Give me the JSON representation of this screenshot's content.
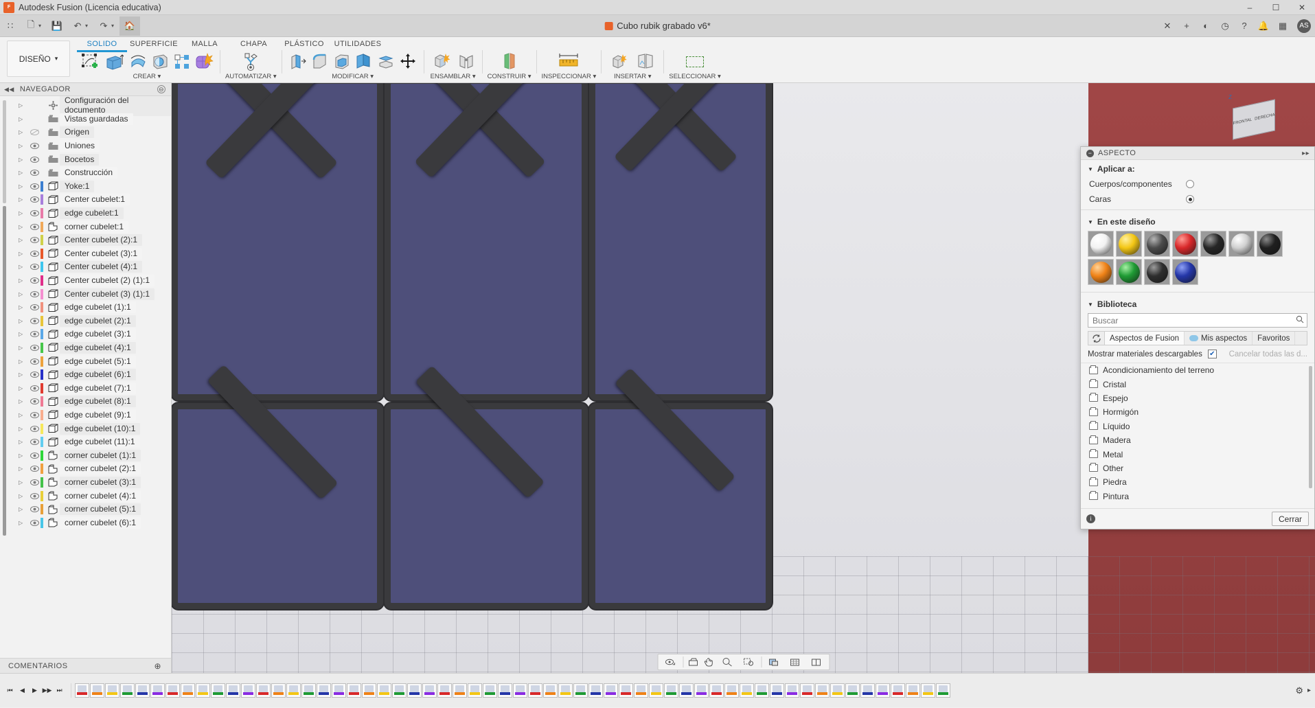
{
  "titlebar": {
    "app_name": "Autodesk Fusion (Licencia educativa)",
    "app_icon": "fusion-logo-icon",
    "minimize": "–",
    "maximize": "☐",
    "close": "✕"
  },
  "quickaccess": {
    "grid_icon": "∷",
    "new_icon": "🗋",
    "save_icon": "💾",
    "undo_icon": "↶",
    "redo_icon": "↷",
    "home_icon": "🏠",
    "caret": "▾",
    "document_name": "Cubo rubik grabado v6*",
    "doc_close": "✕",
    "add_tab": "+",
    "extensions_icon": "◐",
    "help_icon": "?",
    "jobs_icon": "◷",
    "notify_icon": "🔔",
    "grid_right_icon": "▦",
    "user_initials": "AS"
  },
  "ribbon": {
    "workspace_label": "DISEÑO",
    "workspace_caret": "▾",
    "tabs": [
      {
        "label": "SOLIDO",
        "active": true
      },
      {
        "label": "SUPERFICIE",
        "active": false
      },
      {
        "label": "MALLA",
        "active": false
      },
      {
        "label": "CHAPA",
        "active": false
      },
      {
        "label": "PLÁSTICO",
        "active": false
      },
      {
        "label": "UTILIDADES",
        "active": false
      }
    ],
    "groups": [
      {
        "label": "CREAR ▾",
        "icons": [
          "create-sketch-icon",
          "extrude-icon",
          "revolve-icon",
          "sweep-icon",
          "loft-icon",
          "pattern-icon",
          "form-icon"
        ]
      },
      {
        "label": "AUTOMATIZAR ▾",
        "icons": [
          "automate-icon"
        ]
      },
      {
        "label": "MODIFICAR ▾",
        "icons": [
          "press-pull-icon",
          "fillet-icon",
          "shell-icon",
          "draft-icon",
          "split-body-icon",
          "move-copy-icon"
        ]
      },
      {
        "label": "ENSAMBLAR ▾",
        "icons": [
          "new-component-icon",
          "joint-icon"
        ]
      },
      {
        "label": "CONSTRUIR ▾",
        "icons": [
          "construction-plane-icon"
        ]
      },
      {
        "label": "INSPECCIONAR ▾",
        "icons": [
          "measure-icon"
        ]
      },
      {
        "label": "INSERTAR ▾",
        "icons": [
          "insert-derive-icon",
          "insert-canvas-icon"
        ]
      },
      {
        "label": "SELECCIONAR ▾",
        "icons": [
          "window-selection-icon"
        ]
      }
    ]
  },
  "navigator": {
    "title": "NAVEGADOR",
    "collapse_icon": "◀◀",
    "options_icon": "⊖",
    "arrow": "▷",
    "eye_visible": "◉",
    "eye_hidden": "⊘",
    "footer": "COMENTARIOS",
    "footer_icon": "⊕",
    "items": [
      {
        "label": "Configuración del documento",
        "icon": "gear-icon",
        "swatch": "",
        "eye": "none",
        "indent": 0
      },
      {
        "label": "Vistas guardadas",
        "icon": "folder-icon",
        "swatch": "",
        "eye": "none",
        "indent": 1
      },
      {
        "label": "Origen",
        "icon": "folder-icon",
        "swatch": "",
        "eye": "hidden",
        "indent": 1
      },
      {
        "label": "Uniones",
        "icon": "folder-icon",
        "swatch": "",
        "eye": "visible",
        "indent": 1
      },
      {
        "label": "Bocetos",
        "icon": "folder-icon",
        "swatch": "",
        "eye": "visible",
        "indent": 1
      },
      {
        "label": "Construcción",
        "icon": "folder-icon",
        "swatch": "",
        "eye": "visible",
        "indent": 1
      },
      {
        "label": "Yoke:1",
        "icon": "component-icon",
        "swatch": "#3d7fd0",
        "eye": "visible",
        "indent": 1
      },
      {
        "label": "Center cubelet:1",
        "icon": "component-icon",
        "swatch": "#a87fdc",
        "eye": "visible",
        "indent": 1
      },
      {
        "label": "edge cubelet:1",
        "icon": "component-icon",
        "swatch": "#e87ba8",
        "eye": "visible",
        "indent": 1
      },
      {
        "label": "corner cubelet:1",
        "icon": "corner-component-icon",
        "swatch": "#f0a95a",
        "eye": "visible",
        "indent": 1
      },
      {
        "label": "Center cubelet (2):1",
        "icon": "component-icon",
        "swatch": "#cfd14a",
        "eye": "visible",
        "indent": 1
      },
      {
        "label": "Center cubelet (3):1",
        "icon": "component-icon",
        "swatch": "#e8582a",
        "eye": "visible",
        "indent": 1
      },
      {
        "label": "Center cubelet (4):1",
        "icon": "component-icon",
        "swatch": "#3fc6ee",
        "eye": "visible",
        "indent": 1
      },
      {
        "label": "Center cubelet (2) (1):1",
        "icon": "component-icon",
        "swatch": "#e02f8a",
        "eye": "visible",
        "indent": 1
      },
      {
        "label": "Center cubelet (3) (1):1",
        "icon": "component-icon",
        "swatch": "#f48fd0",
        "eye": "visible",
        "indent": 1
      },
      {
        "label": "edge cubelet (1):1",
        "icon": "component-icon",
        "swatch": "#f0917e",
        "eye": "visible",
        "indent": 1
      },
      {
        "label": "edge cubelet (2):1",
        "icon": "component-icon",
        "swatch": "#e8c53a",
        "eye": "visible",
        "indent": 1
      },
      {
        "label": "edge cubelet (3):1",
        "icon": "component-icon",
        "swatch": "#5aa8e8",
        "eye": "visible",
        "indent": 1
      },
      {
        "label": "edge cubelet (4):1",
        "icon": "component-icon",
        "swatch": "#47c64a",
        "eye": "visible",
        "indent": 1
      },
      {
        "label": "edge cubelet (5):1",
        "icon": "component-icon",
        "swatch": "#eda23c",
        "eye": "visible",
        "indent": 1
      },
      {
        "label": "edge cubelet (6):1",
        "icon": "component-icon",
        "swatch": "#2730c8",
        "eye": "visible",
        "indent": 1
      },
      {
        "label": "edge cubelet (7):1",
        "icon": "component-icon",
        "swatch": "#e03b30",
        "eye": "visible",
        "indent": 1
      },
      {
        "label": "edge cubelet (8):1",
        "icon": "component-icon",
        "swatch": "#ef7a94",
        "eye": "visible",
        "indent": 1
      },
      {
        "label": "edge cubelet (9):1",
        "icon": "component-icon",
        "swatch": "#f9ad8e",
        "eye": "visible",
        "indent": 1
      },
      {
        "label": "edge cubelet (10):1",
        "icon": "component-icon",
        "swatch": "#f7e85c",
        "eye": "visible",
        "indent": 1
      },
      {
        "label": "edge cubelet (11):1",
        "icon": "component-icon",
        "swatch": "#61cdf0",
        "eye": "visible",
        "indent": 1
      },
      {
        "label": "corner cubelet (1):1",
        "icon": "corner-component-icon",
        "swatch": "#2fd63a",
        "eye": "visible",
        "indent": 1
      },
      {
        "label": "corner cubelet (2):1",
        "icon": "corner-component-icon",
        "swatch": "#f0a040",
        "eye": "visible",
        "indent": 1
      },
      {
        "label": "corner cubelet (3):1",
        "icon": "corner-component-icon",
        "swatch": "#44c24a",
        "eye": "visible",
        "indent": 1
      },
      {
        "label": "corner cubelet (4):1",
        "icon": "corner-component-icon",
        "swatch": "#e8cf3a",
        "eye": "visible",
        "indent": 1
      },
      {
        "label": "corner cubelet (5):1",
        "icon": "corner-component-icon",
        "swatch": "#e8a03a",
        "eye": "visible",
        "indent": 1
      },
      {
        "label": "corner cubelet (6):1",
        "icon": "corner-component-icon",
        "swatch": "#49c6e8",
        "eye": "visible",
        "indent": 1
      }
    ]
  },
  "viewport": {
    "viewcube_labels": [
      "FRONTAL",
      "DERECHA"
    ],
    "axis_label": "Z",
    "toolbar_icons": [
      "orbit-icon",
      "look-at-icon",
      "pan-icon",
      "zoom-icon",
      "zoom-window-icon",
      "display-settings-icon",
      "grid-snap-icon",
      "viewports-icon"
    ]
  },
  "aspecto": {
    "title": "ASPECTO",
    "minimize_icon": "−",
    "pin_icon": "▸▸",
    "tri": "▼",
    "apply_section": "Aplicar a:",
    "apply_options": [
      {
        "label": "Cuerpos/componentes",
        "selected": false
      },
      {
        "label": "Caras",
        "selected": true
      }
    ],
    "in_design_section": "En este diseño",
    "materials": [
      {
        "name": "white-ball",
        "color": "#f2f2f2",
        "hi": "#ffffff"
      },
      {
        "name": "yellow-ball",
        "color": "#f3c614",
        "hi": "#fff0a0"
      },
      {
        "name": "dark-gray-ball",
        "color": "#4b4b4b",
        "hi": "#b6b6b6"
      },
      {
        "name": "red-ball",
        "color": "#d8282a",
        "hi": "#ff9a93"
      },
      {
        "name": "black-ball",
        "color": "#262626",
        "hi": "#9a9a9a"
      },
      {
        "name": "light-gray-ball",
        "color": "#d0d0d0",
        "hi": "#ffffff"
      },
      {
        "name": "black-matte-ball",
        "color": "#1f1f1f",
        "hi": "#8a8a8a"
      },
      {
        "name": "orange-ball",
        "color": "#ef8217",
        "hi": "#ffd49a"
      },
      {
        "name": "green-ball",
        "color": "#1f9b34",
        "hi": "#a7f0a5"
      },
      {
        "name": "dark-ball",
        "color": "#2e2e2e",
        "hi": "#9c9c9c"
      },
      {
        "name": "blue-ball",
        "color": "#2436a8",
        "hi": "#8ea0f5"
      }
    ],
    "library_section": "Biblioteca",
    "search_placeholder": "Buscar",
    "search_value": "",
    "search_icon": "🔍",
    "refresh_icon": "↻",
    "lib_tabs": [
      {
        "label": "Aspectos de Fusion",
        "active": true,
        "icon": ""
      },
      {
        "label": "Mis aspectos",
        "active": false,
        "icon": "cloud-icon"
      },
      {
        "label": "Favoritos",
        "active": false,
        "icon": ""
      }
    ],
    "show_downloadable_label": "Mostrar materiales descargables",
    "show_downloadable_checked": true,
    "check_glyph": "✔",
    "cancel_all_label": "Cancelar todas las d...",
    "categories": [
      "Acondicionamiento del terreno",
      "Cristal",
      "Espejo",
      "Hormigón",
      "Líquido",
      "Madera",
      "Metal",
      "Other",
      "Piedra",
      "Pintura"
    ],
    "info_icon": "i",
    "close_button": "Cerrar"
  },
  "timeline": {
    "nav_icons": [
      "⏮",
      "◀",
      "▶",
      "▶▶",
      "⏭"
    ],
    "node_colors": [
      "#d8282a",
      "#ef8217",
      "#f3c614",
      "#1f9b34",
      "#2436a8",
      "#8a2be2",
      "#d8282a",
      "#ef8217",
      "#f3c614",
      "#1f9b34",
      "#2436a8",
      "#8a2be2",
      "#d8282a",
      "#ef8217",
      "#f3c614",
      "#1f9b34",
      "#2436a8",
      "#8a2be2",
      "#d8282a",
      "#ef8217",
      "#f3c614",
      "#1f9b34",
      "#2436a8",
      "#8a2be2",
      "#d8282a",
      "#ef8217",
      "#f3c614",
      "#1f9b34",
      "#2436a8",
      "#8a2be2",
      "#d8282a",
      "#ef8217",
      "#f3c614",
      "#1f9b34",
      "#2436a8",
      "#8a2be2",
      "#d8282a",
      "#ef8217",
      "#f3c614",
      "#1f9b34",
      "#2436a8",
      "#8a2be2",
      "#d8282a",
      "#ef8217",
      "#f3c614",
      "#1f9b34",
      "#2436a8",
      "#8a2be2",
      "#d8282a",
      "#ef8217",
      "#f3c614",
      "#1f9b34",
      "#2436a8",
      "#8a2be2",
      "#d8282a",
      "#ef8217",
      "#f3c614",
      "#1f9b34"
    ],
    "settings_icon": "⚙",
    "expand_icon": "▸"
  }
}
